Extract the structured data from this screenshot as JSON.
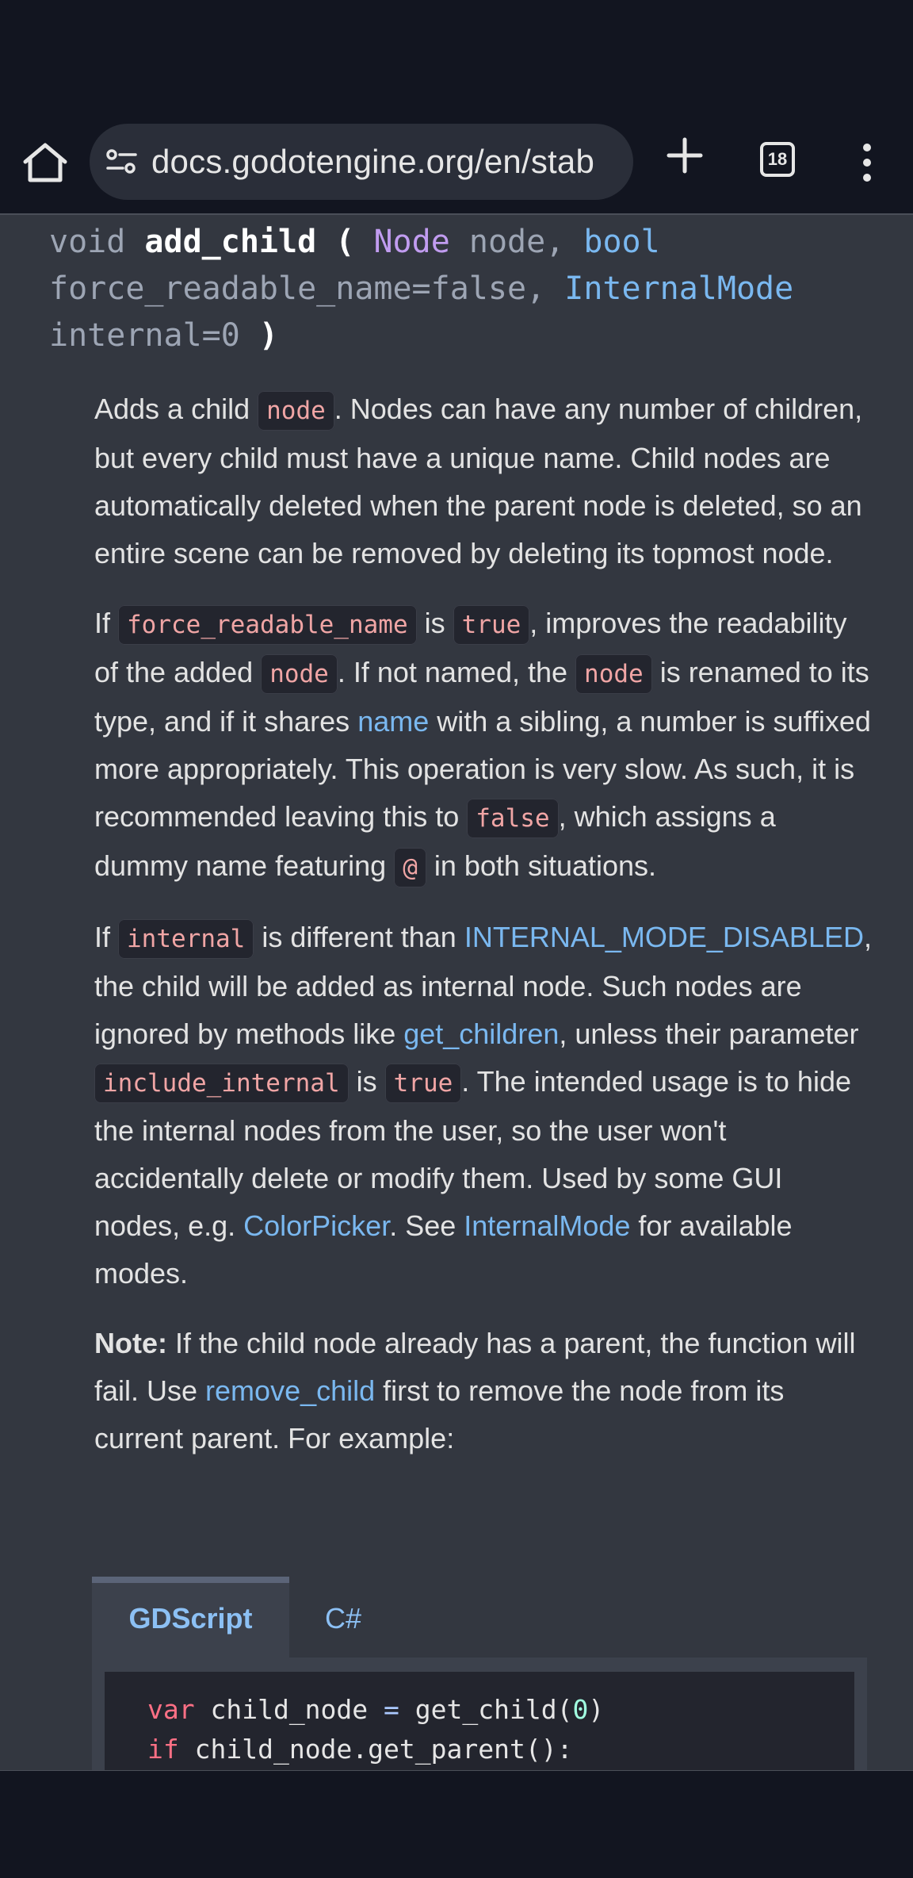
{
  "browser": {
    "url": "docs.godotengine.org/en/stab",
    "tab_count": "18",
    "icons": [
      "home-icon",
      "site-settings-icon",
      "new-tab-icon",
      "tab-switcher-icon",
      "more-menu-icon"
    ]
  },
  "signature": {
    "ret": "void",
    "name": "add_child",
    "open_paren": "(",
    "type1": "Node",
    "arg1": "node,",
    "type2": "bool",
    "arg2": "force_readable_name=false,",
    "type3": "InternalMode",
    "arg3": "internal=0",
    "close_paren": ")"
  },
  "desc": {
    "p1_a": "Adds a child ",
    "p1_code": "node",
    "p1_b": ". Nodes can have any number of children, but every child must have a unique name. Child nodes are automatically deleted when the parent node is deleted, so an entire scene can be removed by deleting its topmost node.",
    "p2_a": "If ",
    "p2_code1": "force_readable_name",
    "p2_b": " is ",
    "p2_code2": "true",
    "p2_c": ", improves the readability of the added ",
    "p2_code3": "node",
    "p2_d": ". If not named, the ",
    "p2_code4": "node",
    "p2_e": " is renamed to its type, and if it shares ",
    "p2_link": "name",
    "p2_f": " with a sibling, a number is suffixed more appropriately. This operation is very slow. As such, it is recommended leaving this to ",
    "p2_code5": "false",
    "p2_g": ", which assigns a dummy name featuring ",
    "p2_code6": "@",
    "p2_h": " in both situations.",
    "p3_a": "If ",
    "p3_code1": "internal",
    "p3_b": " is different than ",
    "p3_link1": "INTERNAL_MODE_DISABLED",
    "p3_c": ", the child will be added as internal node. Such nodes are ignored by methods like ",
    "p3_link2": "get_children",
    "p3_d": ", unless their parameter ",
    "p3_code2": "include_internal",
    "p3_e": " is ",
    "p3_code3": "true",
    "p3_f": ". The intended usage is to hide the internal nodes from the user, so the user won't accidentally delete or modify them. Used by some GUI nodes, e.g. ",
    "p3_link3": "ColorPicker",
    "p3_g": ". See ",
    "p3_link4": "InternalMode",
    "p3_h": " for available modes.",
    "p4_bold": "Note:",
    "p4_a": " If the child node already has a parent, the function will fail. Use ",
    "p4_link": "remove_child",
    "p4_b": " first to remove the node from its current parent. For example:"
  },
  "codeblock": {
    "tabs": [
      "GDScript",
      "C#"
    ],
    "active_tab": "GDScript",
    "line1_kw": "var",
    "line1_a": " child_node ",
    "line1_op": "=",
    "line1_b": " get_child(",
    "line1_num": "0",
    "line1_c": ")",
    "line2_kw": "if",
    "line2_a": " child_node.get_parent():"
  },
  "colors": {
    "background": "#333740",
    "link": "#7ab8f0",
    "inline_code": "#f0a5a5",
    "keyword": "#ff7085"
  }
}
